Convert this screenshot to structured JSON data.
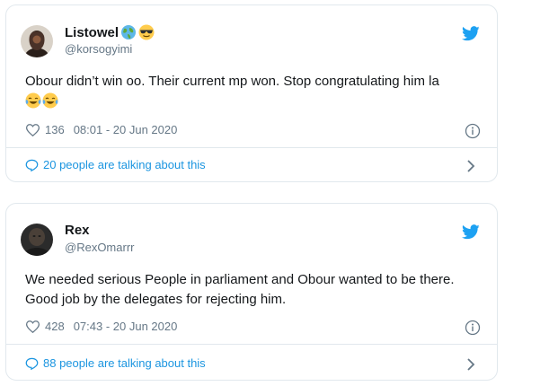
{
  "tweets": [
    {
      "name": "Listowel",
      "name_emoji": [
        "globe-icon",
        "sunglasses-emoji-icon"
      ],
      "handle": "@korsogyimi",
      "text": "Obour didn’t win oo. Their current mp won. Stop congratulating him la",
      "text_emoji": [
        "tears-of-joy-emoji-icon",
        "tears-of-joy-emoji-icon"
      ],
      "likes": "136",
      "timestamp": "08:01 - 20 Jun 2020",
      "talking": "20 people are talking about this"
    },
    {
      "name": "Rex",
      "handle": "@RexOmarrr",
      "text": "We needed serious People in parliament and Obour wanted to be there. Good job by the delegates for rejecting him.",
      "likes": "428",
      "timestamp": "07:43 - 20 Jun 2020",
      "talking": "88 people are talking about this"
    }
  ],
  "colors": {
    "accent": "#1b95e0",
    "twitter_bird": "#1da1f2",
    "secondary_text": "#657786",
    "border": "#e1e8ed"
  }
}
